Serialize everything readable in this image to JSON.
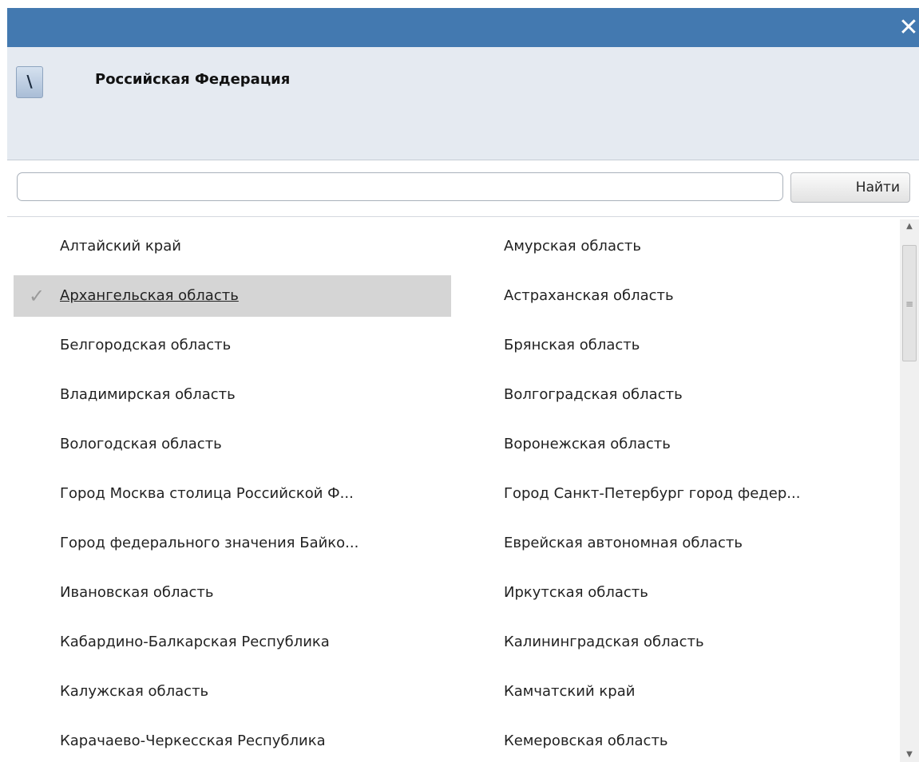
{
  "window": {
    "close_glyph": "✕"
  },
  "header": {
    "up_button_label": "\\",
    "title": "Российская Федерация"
  },
  "search": {
    "value": "",
    "placeholder": "",
    "button_label": "Найти"
  },
  "selected_region": "Архангельская область",
  "regions": [
    {
      "label": "Алтайский край",
      "selected": false
    },
    {
      "label": "Амурская область",
      "selected": false
    },
    {
      "label": "Архангельская область",
      "selected": true
    },
    {
      "label": "Астраханская область",
      "selected": false
    },
    {
      "label": "Белгородская область",
      "selected": false
    },
    {
      "label": "Брянская область",
      "selected": false
    },
    {
      "label": "Владимирская область",
      "selected": false
    },
    {
      "label": "Волгоградская область",
      "selected": false
    },
    {
      "label": "Вологодская область",
      "selected": false
    },
    {
      "label": "Воронежская область",
      "selected": false
    },
    {
      "label": "Город Москва столица Российской Ф...",
      "selected": false
    },
    {
      "label": "Город Санкт-Петербург город федер...",
      "selected": false
    },
    {
      "label": "Город федерального значения Байко...",
      "selected": false
    },
    {
      "label": "Еврейская автономная область",
      "selected": false
    },
    {
      "label": "Ивановская область",
      "selected": false
    },
    {
      "label": "Иркутская область",
      "selected": false
    },
    {
      "label": "Кабардино-Балкарская Республика",
      "selected": false
    },
    {
      "label": "Калининградская область",
      "selected": false
    },
    {
      "label": "Калужская область",
      "selected": false
    },
    {
      "label": "Камчатский край",
      "selected": false
    },
    {
      "label": "Карачаево-Черкесская Республика",
      "selected": false
    },
    {
      "label": "Кемеровская область",
      "selected": false
    }
  ],
  "colors": {
    "titlebar": "#4379b0",
    "header_bg": "#e5eaf1",
    "selected_row": "#d5d5d5",
    "checkmark": "#9a9a9a"
  }
}
